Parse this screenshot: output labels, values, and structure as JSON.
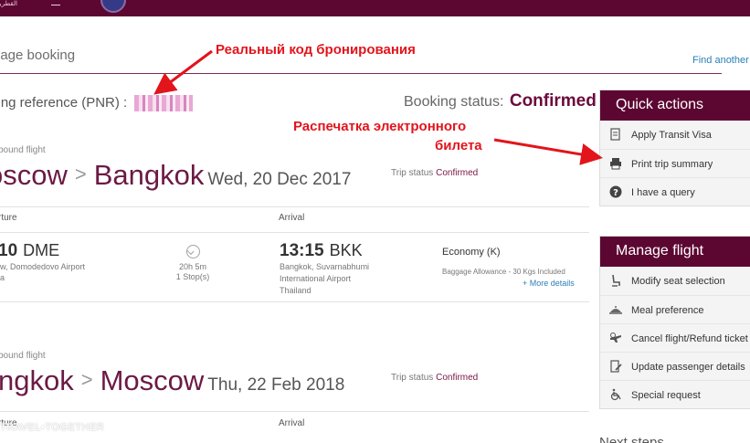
{
  "header": {
    "logo_text": "القطرية",
    "page_title": "nage booking",
    "find_another": "Find another"
  },
  "booking": {
    "reference_label": "king reference (PNR) :",
    "status_label": "Booking status:",
    "status_value": "Confirmed"
  },
  "outbound": {
    "type_label": "bound flight",
    "origin": "oscow",
    "destination": "Bangkok",
    "separator": ">",
    "date": "Wed, 20 Dec 2017",
    "trip_status_label": "Trip status",
    "trip_status_value": "Confirmed",
    "departure_label": "rture",
    "arrival_label": "Arrival",
    "dep_time": "10",
    "dep_code": "DME",
    "dep_airport": "w, Domodedovo Airport",
    "dep_extra": "a",
    "duration": "20h 5m",
    "stops": "1 Stop(s)",
    "arr_time": "13:15",
    "arr_code": "BKK",
    "arr_airport_line1": "Bangkok, Suvarnabhumi",
    "arr_airport_line2": "International Airport",
    "arr_airport_line3": "Thailand",
    "cabin": "Economy (K)",
    "baggage": "Baggage Allowance - 30 Kgs Included",
    "more_details": "+ More details"
  },
  "inbound": {
    "type_label": "bound flight",
    "origin": "ngkok",
    "destination": "Moscow",
    "separator": ">",
    "date": "Thu, 22 Feb 2018",
    "trip_status_label": "Trip status",
    "trip_status_value": "Confirmed",
    "departure_label": "rture",
    "arrival_label": "Arrival"
  },
  "quick_actions": {
    "title": "Quick actions",
    "items": [
      {
        "label": "Apply Transit Visa",
        "icon": "visa-document-icon"
      },
      {
        "label": "Print trip summary",
        "icon": "printer-icon"
      },
      {
        "label": "I have a query",
        "icon": "question-icon"
      }
    ]
  },
  "manage_flight": {
    "title": "Manage flight",
    "items": [
      {
        "label": "Modify seat selection",
        "icon": "seat-icon"
      },
      {
        "label": "Meal preference",
        "icon": "meal-icon"
      },
      {
        "label": "Cancel flight/Refund ticket",
        "icon": "cancel-flight-icon"
      },
      {
        "label": "Update passenger details",
        "icon": "edit-document-icon"
      },
      {
        "label": "Special request",
        "icon": "wheelchair-icon"
      }
    ]
  },
  "next_steps": "Next steps",
  "annotations": {
    "pnr": "Реальный код бронирования",
    "print_line1": "Распечатка электронного",
    "print_line2": "билета"
  },
  "watermark": "TRAVEL•TOGETHER",
  "colors": {
    "brand": "#5c0632",
    "accent_text": "#6b0a3d",
    "link": "#2a7fb8",
    "annotation": "#e2141c"
  }
}
